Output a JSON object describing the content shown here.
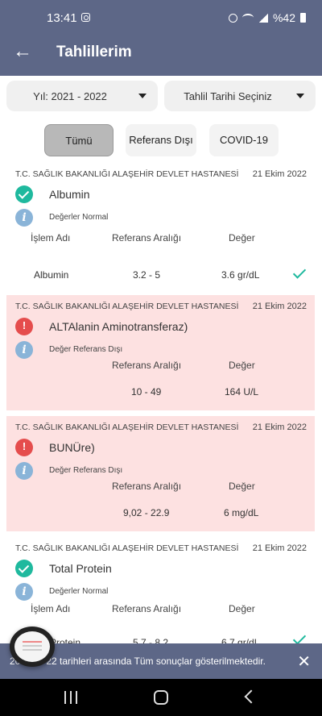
{
  "status_bar": {
    "time": "13:41",
    "battery": "%42"
  },
  "app_bar": {
    "title": "Tahlillerim",
    "back_icon": "arrow-left-icon"
  },
  "filters": {
    "year": "Yıl: 2021 - 2022",
    "date": "Tahlil Tarihi Seçiniz"
  },
  "chips": [
    {
      "label": "Tümü",
      "selected": true
    },
    {
      "label": "Referans Dışı",
      "selected": false
    },
    {
      "label": "COVID-19",
      "selected": false
    }
  ],
  "columns": {
    "name": "İşlem Adı",
    "range": "Referans Aralığı",
    "value": "Değer"
  },
  "results": [
    {
      "hospital": "T.C. SAĞLIK BAKANLIĞI ALAŞEHİR DEVLET HASTANESİ",
      "date": "21 Ekim 2022",
      "status": "normal",
      "test_name": "Albumin",
      "info": "Değerler Normal",
      "row_name": "Albumin",
      "range": "3.2 - 5",
      "value": "3.6 gr/dL"
    },
    {
      "hospital": "T.C. SAĞLIK BAKANLIĞI ALAŞEHİR DEVLET HASTANESİ",
      "date": "21 Ekim 2022",
      "status": "out_of_range",
      "test_name": "ALTAlanin Aminotransferaz)",
      "info": "Değer Referans Dışı",
      "range": "10 - 49",
      "value": "164 U/L"
    },
    {
      "hospital": "T.C. SAĞLIK BAKANLIĞI ALAŞEHİR DEVLET HASTANESİ",
      "date": "21 Ekim 2022",
      "status": "out_of_range",
      "test_name": "BUNÜre)",
      "info": "Değer Referans Dışı",
      "range": "9,02 - 22.9",
      "value": "6 mg/dL"
    },
    {
      "hospital": "T.C. SAĞLIK BAKANLIĞI ALAŞEHİR DEVLET HASTANESİ",
      "date": "21 Ekim 2022",
      "status": "normal",
      "test_name": "Total Protein",
      "info": "Değerler Normal",
      "row_name": "Protein",
      "range": "5.7 - 8.2",
      "value": "6.7 gr/dL"
    }
  ],
  "snackbar": {
    "message": "20",
    "message_tail": "22 tarihleri arasında Tüm sonuçlar gösterilmektedir."
  },
  "colors": {
    "primary": "#5d6787",
    "ok": "#1fb99e",
    "alert_bg": "#fde1e1",
    "warn": "#e54d4d"
  }
}
